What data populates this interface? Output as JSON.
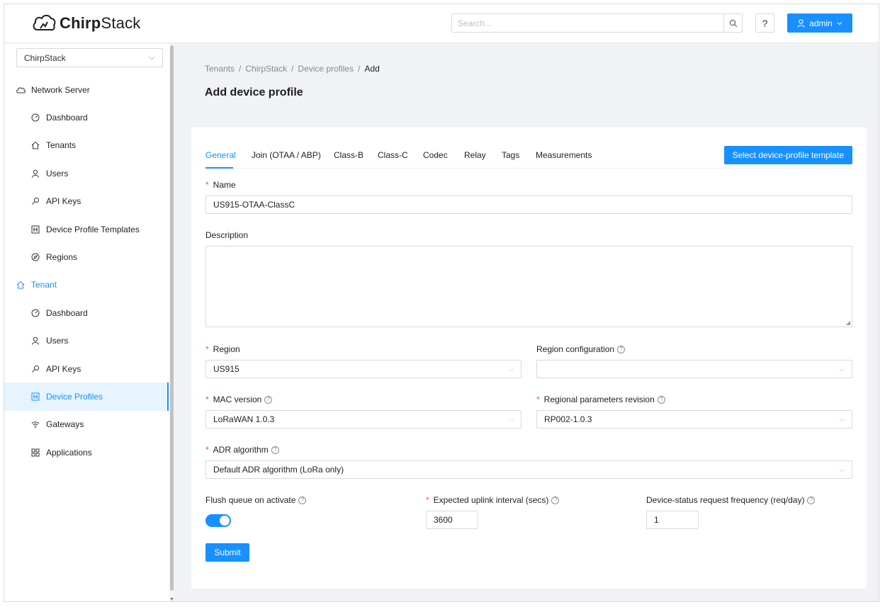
{
  "header": {
    "brand_bold": "Chirp",
    "brand_light": "Stack",
    "search_placeholder": "Search...",
    "help_label": "?",
    "user_label": "admin"
  },
  "sidebar": {
    "tenant_select": "ChirpStack",
    "network_server": {
      "label": "Network Server",
      "items": [
        {
          "label": "Dashboard",
          "icon": "dashboard-icon"
        },
        {
          "label": "Tenants",
          "icon": "home-icon"
        },
        {
          "label": "Users",
          "icon": "user-icon"
        },
        {
          "label": "API Keys",
          "icon": "key-icon"
        },
        {
          "label": "Device Profile Templates",
          "icon": "template-icon"
        },
        {
          "label": "Regions",
          "icon": "compass-icon"
        }
      ]
    },
    "tenant": {
      "label": "Tenant",
      "items": [
        {
          "label": "Dashboard",
          "icon": "dashboard-icon"
        },
        {
          "label": "Users",
          "icon": "user-icon"
        },
        {
          "label": "API Keys",
          "icon": "key-icon"
        },
        {
          "label": "Device Profiles",
          "icon": "template-icon"
        },
        {
          "label": "Gateways",
          "icon": "wifi-icon"
        },
        {
          "label": "Applications",
          "icon": "apps-icon"
        }
      ]
    }
  },
  "breadcrumb": [
    "Tenants",
    "ChirpStack",
    "Device profiles",
    "Add"
  ],
  "page_title": "Add device profile",
  "tabs": [
    "General",
    "Join (OTAA / ABP)",
    "Class-B",
    "Class-C",
    "Codec",
    "Relay",
    "Tags",
    "Measurements"
  ],
  "template_button": "Select device-profile template",
  "form": {
    "name": {
      "label": "Name",
      "value": "US915-OTAA-ClassC"
    },
    "description": {
      "label": "Description",
      "value": ""
    },
    "region": {
      "label": "Region",
      "value": "US915"
    },
    "region_config": {
      "label": "Region configuration",
      "value": ""
    },
    "mac_version": {
      "label": "MAC version",
      "value": "LoRaWAN 1.0.3"
    },
    "regional_params": {
      "label": "Regional parameters revision",
      "value": "RP002-1.0.3"
    },
    "adr_algorithm": {
      "label": "ADR algorithm",
      "value": "Default ADR algorithm (LoRa only)"
    },
    "flush_queue": {
      "label": "Flush queue on activate",
      "value": true
    },
    "uplink_interval": {
      "label": "Expected uplink interval (secs)",
      "value": "3600"
    },
    "status_freq": {
      "label": "Device-status request frequency (req/day)",
      "value": "1"
    }
  },
  "submit_label": "Submit",
  "colors": {
    "primary": "#1890ff",
    "required": "#ff4d4f"
  }
}
